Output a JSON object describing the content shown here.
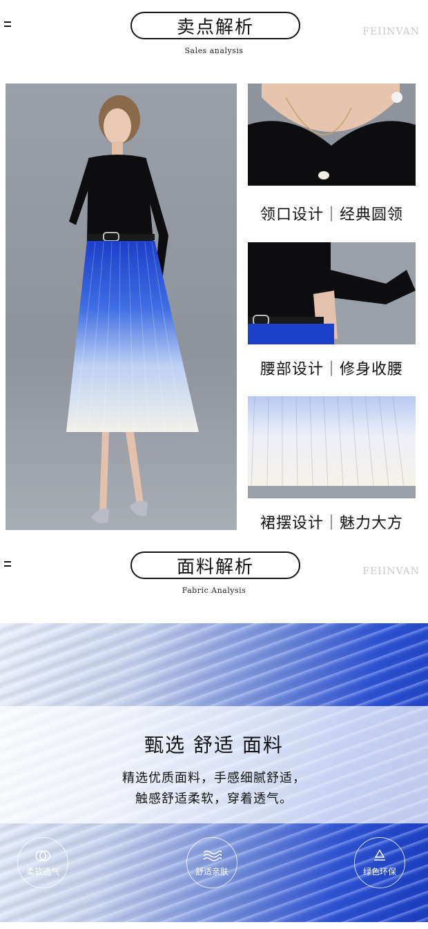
{
  "sales": {
    "title": "卖点解析",
    "subtitle": "Sales analysis",
    "brand": "FEIINVAN",
    "details": [
      {
        "caption": "领口设计｜经典圆领",
        "icon": "necklace-detail-photo"
      },
      {
        "caption": "腰部设计｜修身收腰",
        "icon": "waist-belt-detail-photo"
      },
      {
        "caption": "裙摆设计｜魅力大方",
        "icon": "pleated-hem-detail-photo"
      }
    ]
  },
  "fabric": {
    "title": "面料解析",
    "subtitle": "Fabric Analysis",
    "brand": "FEIINVAN",
    "headline": "甄选 舒适 面料",
    "line1": "精选优质面料，手感细腻舒适，",
    "line2": "触感舒适柔软，穿着透气。",
    "badges": [
      {
        "label": "柔软透气",
        "icon": "soft-circles-icon"
      },
      {
        "label": "舒适亲肤",
        "icon": "wave-icon"
      },
      {
        "label": "绿色环保",
        "icon": "recycle-icon"
      }
    ]
  },
  "colors": {
    "blue": "#1b3fc4",
    "black": "#111111",
    "gray": "#c9c9c9"
  }
}
